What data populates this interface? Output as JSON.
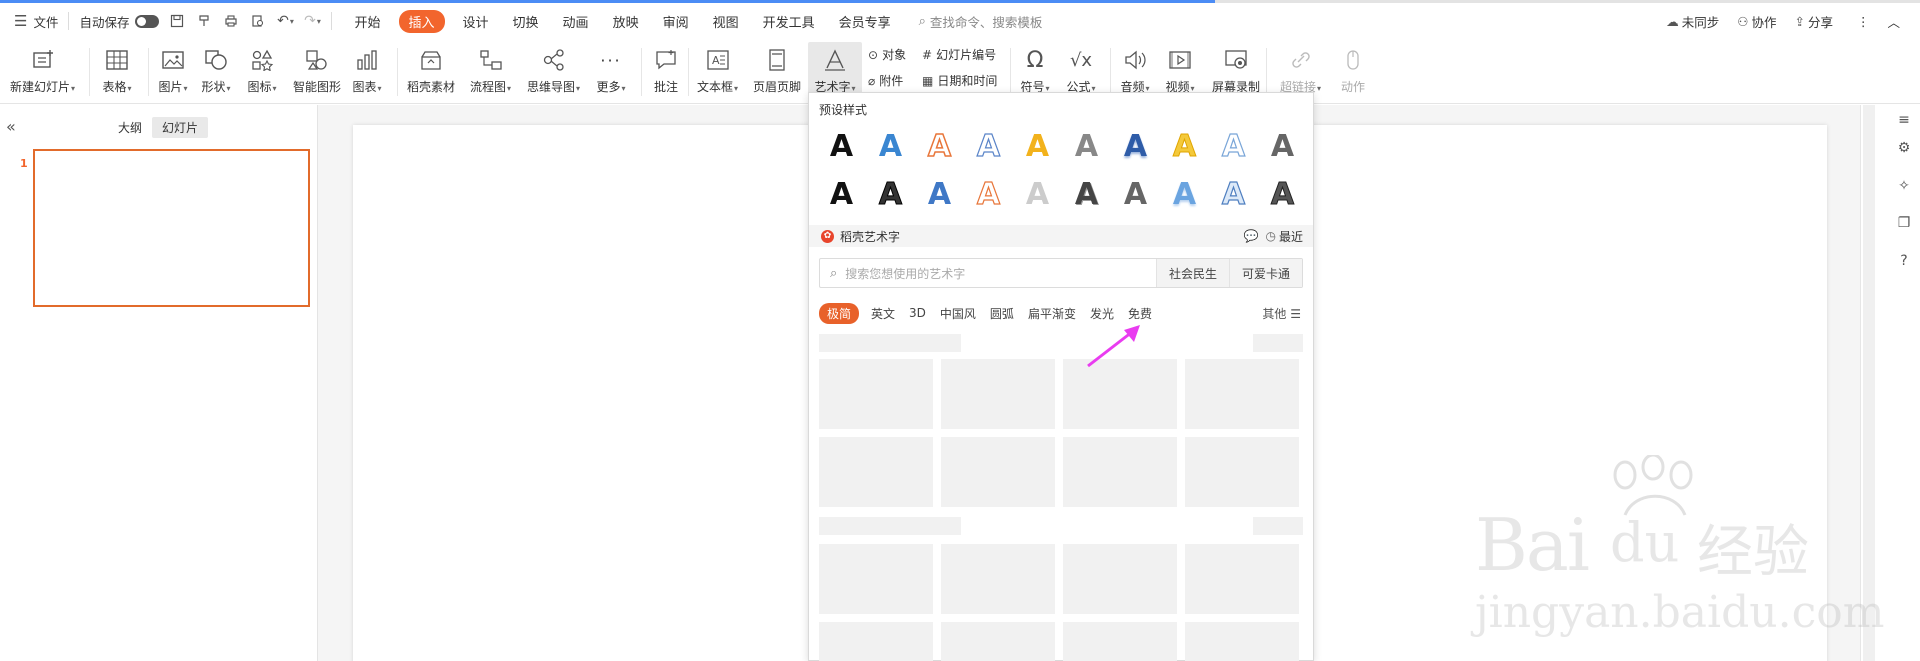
{
  "menubar": {
    "file_label": "文件",
    "autosave_label": "自动保存",
    "tabs": [
      "开始",
      "插入",
      "设计",
      "切换",
      "动画",
      "放映",
      "审阅",
      "视图",
      "开发工具",
      "会员专享"
    ],
    "active_tab": "插入",
    "search_placeholder": "查找命令、搜索模板",
    "right": {
      "sync": "未同步",
      "collab": "协作",
      "share": "分享"
    }
  },
  "ribbon": {
    "new_slide": "新建幻灯片",
    "table": "表格",
    "picture": "图片",
    "shape": "形状",
    "icon": "图标",
    "smartart": "智能图形",
    "chart": "图表",
    "shell_material": "稻壳素材",
    "flowchart": "流程图",
    "mindmap": "思维导图",
    "more": "更多",
    "comment": "批注",
    "textbox": "文本框",
    "header_footer": "页眉页脚",
    "wordart": "艺术字",
    "object": "对象",
    "attachment": "附件",
    "slide_number": "幻灯片编号",
    "date_time": "日期和时间",
    "symbol": "符号",
    "formula": "公式",
    "audio": "音频",
    "video": "视频",
    "screen_record": "屏幕录制",
    "hyperlink": "超链接",
    "action": "动作"
  },
  "left_panel": {
    "tab_outline": "大纲",
    "tab_slides": "幻灯片",
    "slide_number": "1"
  },
  "wordart_panel": {
    "preset_title": "预设样式",
    "preset_glyph": "A",
    "section_name": "稻壳艺术字",
    "recent_label": "最近",
    "search_placeholder": "搜索您想使用的艺术字",
    "search_chips": [
      "社会民生",
      "可爱卡通"
    ],
    "categories": [
      "极简",
      "英文",
      "3D",
      "中国风",
      "圆弧",
      "扁平渐变",
      "发光",
      "免费"
    ],
    "active_category": "极简",
    "other_label": "其他 ☰"
  },
  "watermark": {
    "brand": "Bai",
    "brand2": "du",
    "cn": "经验",
    "url": "jingyan.baidu.com"
  },
  "colors": {
    "accent": "#f2652d",
    "progress": "#4b8cf5",
    "slide_border": "#e26b2b"
  }
}
